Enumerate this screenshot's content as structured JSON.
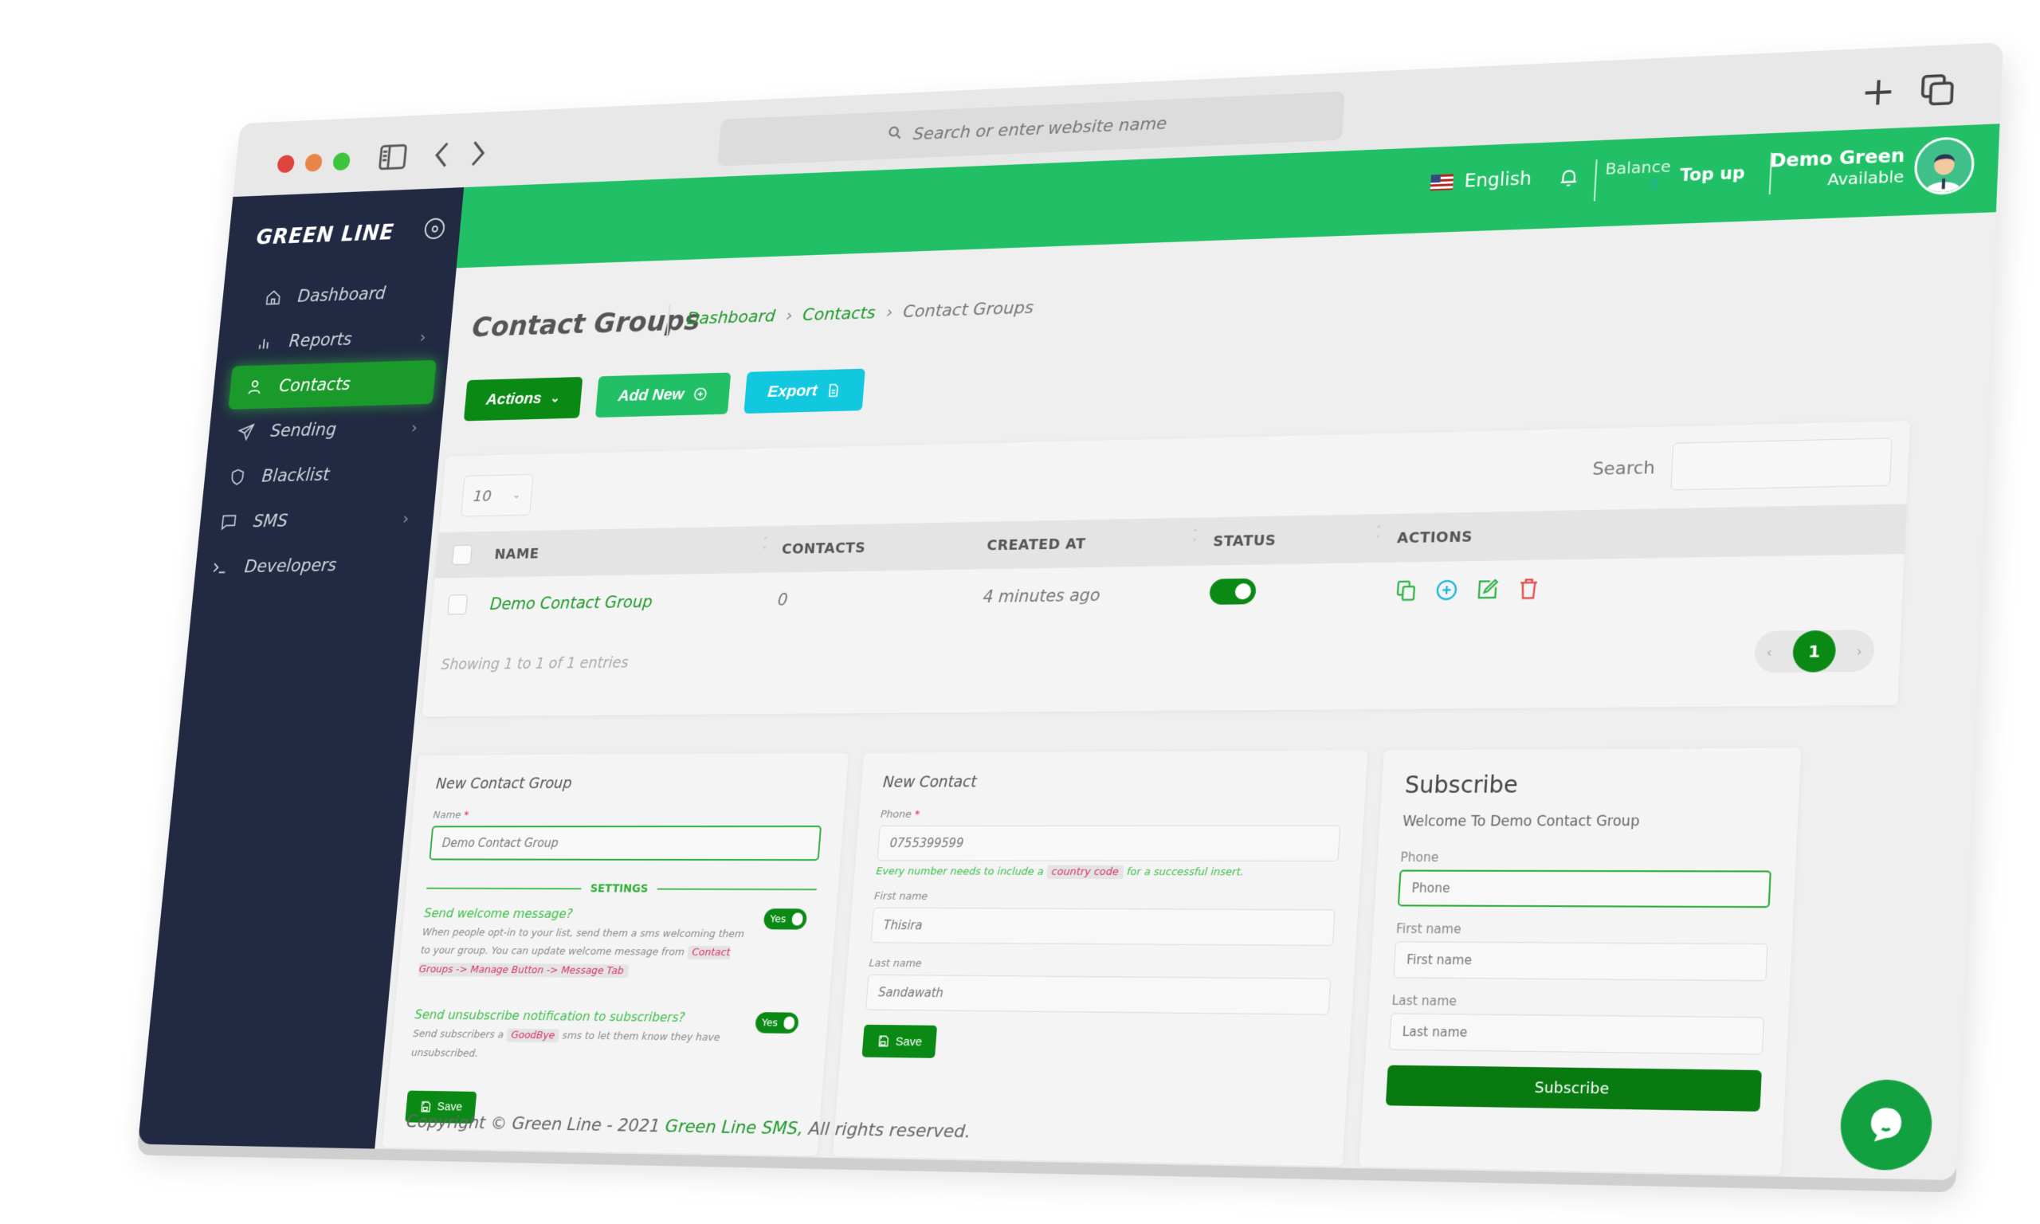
{
  "browser": {
    "url_placeholder": "Search or enter website name",
    "icons": [
      "sidebar-icon",
      "back-icon",
      "forward-icon",
      "new-tab-icon",
      "tabs-overview-icon"
    ]
  },
  "sidebar": {
    "brand": "GREEN LINE",
    "items": [
      {
        "label": "Dashboard",
        "icon": "home-icon",
        "has_submenu": false,
        "active": false
      },
      {
        "label": "Reports",
        "icon": "bar-chart-icon",
        "has_submenu": true,
        "active": false
      },
      {
        "label": "Contacts",
        "icon": "user-icon",
        "has_submenu": false,
        "active": true
      },
      {
        "label": "Sending",
        "icon": "send-icon",
        "has_submenu": true,
        "active": false
      },
      {
        "label": "Blacklist",
        "icon": "shield-icon",
        "has_submenu": false,
        "active": false
      },
      {
        "label": "SMS",
        "icon": "message-icon",
        "has_submenu": true,
        "active": false
      },
      {
        "label": "Developers",
        "icon": "terminal-icon",
        "has_submenu": false,
        "active": false
      }
    ]
  },
  "topbar": {
    "language": "English",
    "balance_label": "Balance",
    "balance_value": "3",
    "topup_label": "Top up",
    "user_name": "Demo Green",
    "user_status": "Available"
  },
  "page": {
    "title": "Contact Groups",
    "breadcrumb": [
      {
        "label": "Dashboard",
        "link": true
      },
      {
        "label": "Contacts",
        "link": true
      },
      {
        "label": "Contact Groups",
        "link": false
      }
    ],
    "buttons": {
      "actions": "Actions",
      "add_new": "Add New",
      "export": "Export"
    }
  },
  "table": {
    "page_length": "10",
    "search_label": "Search",
    "search_value": "",
    "columns": [
      "NAME",
      "CONTACTS",
      "CREATED AT",
      "STATUS",
      "ACTIONS"
    ],
    "rows": [
      {
        "name": "Demo Contact Group",
        "contacts": "0",
        "created_at": "4 minutes ago",
        "status": true
      }
    ],
    "row_actions": [
      "copy-icon",
      "add-circle-icon",
      "edit-icon",
      "trash-icon"
    ],
    "info": "Showing 1 to 1 of 1 entries",
    "current_page": "1"
  },
  "new_group_form": {
    "title": "New Contact Group",
    "name_label": "Name",
    "name_value": "Demo Contact Group",
    "settings_label": "SETTINGS",
    "welcome": {
      "title": "Send welcome message?",
      "desc": "When people opt-in to your list, send them a sms welcoming them to your group. You can update welcome message from",
      "code": "Contact Groups -> Manage Button -> Message Tab",
      "toggle": "Yes"
    },
    "unsubscribe": {
      "title": "Send unsubscribe notification to subscribers?",
      "desc_before": "Send subscribers a",
      "code": "GoodBye",
      "desc_after": "sms to let them know they have unsubscribed.",
      "toggle": "Yes"
    },
    "save_label": "Save"
  },
  "new_contact_form": {
    "title": "New Contact",
    "phone_label": "Phone",
    "phone_value": "0755399599",
    "help_before": "Every number needs to include a",
    "help_code": "country code",
    "help_after": "for a successful insert.",
    "first_name_label": "First name",
    "first_name_value": "Thisira",
    "last_name_label": "Last name",
    "last_name_value": "Sandawath",
    "save_label": "Save"
  },
  "subscribe_form": {
    "title": "Subscribe",
    "subtitle": "Welcome To Demo Contact Group",
    "phone_label": "Phone",
    "phone_placeholder": "Phone",
    "first_name_label": "First name",
    "first_name_placeholder": "First name",
    "last_name_label": "Last name",
    "last_name_placeholder": "Last name",
    "submit_label": "Subscribe"
  },
  "footer": {
    "prefix": "Copyright © Green Line - 2021",
    "brand": "Green Line SMS,",
    "suffix": "All rights reserved."
  },
  "colors": {
    "primary_green": "#22c066",
    "dark_green": "#0a8a14",
    "sidebar_bg": "#212a42",
    "export_cyan": "#12c8df",
    "danger_red": "#e24a4a"
  }
}
